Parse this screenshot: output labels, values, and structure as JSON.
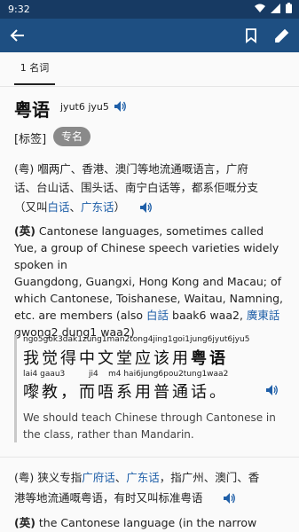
{
  "status": {
    "time": "9:32"
  },
  "toolbar": {
    "back": "back",
    "bookmark": "bookmark",
    "edit": "edit"
  },
  "tab": {
    "label": "1 名词"
  },
  "entry": {
    "headword": "粤语",
    "jyutping": "jyut6 jyu5",
    "tag_label": "[标签]",
    "tag_chip": "专名",
    "def1_zh_line1": "(粤) 嗰两广、香港、澳门等地流通嘅语言，广府",
    "def1_zh_line2": "话、台山话、围头话、南宁白话等，都系佢嘅分支",
    "aka_prefix": "（又叫",
    "aka_link1": "白话",
    "aka_sep": "、",
    "aka_link2": "广东话",
    "aka_suffix": "）",
    "def1_en_prefix": "(英)",
    "def1_en_line1": " Cantonese languages, sometimes called",
    "def1_en_line2": "Yue, a group of Chinese speech varieties widely spoken in",
    "def1_en_line3": "Guangdong, Guangxi, Hong Kong and Macau; of",
    "def1_en_line4": "which Cantonese, Toishanese, Waitau, Namning,",
    "def1_en_line5_a": "etc. are members (also ",
    "def1_en_link1": "白話",
    "def1_en_line5_b": " baak6 waa2, ",
    "def1_en_link2": "廣東話",
    "def1_en_line6": "gwong2 dung1 waa2)"
  },
  "example": {
    "pron1": "ngo5gok3dak1zung1man2tong4jing1goi1jung6jyut6jyu5",
    "line1_plain": "我觉得中文堂应该用",
    "line1_bold": "粤语",
    "pron2_a": "lai4 gaau3",
    "pron2_b": "ji4",
    "pron2_c": "m4 hai6jung6pou2tung1waa2",
    "line2": "嚟教，而唔系用普通话。",
    "translation_line1": "We should teach Chinese through Cantonese in",
    "translation_line2": "the class, rather than Mandarin."
  },
  "def2": {
    "zh_prefix": "(粤) 狭义专指",
    "link1": "广府话",
    "sep": "、",
    "link2": "广东话",
    "zh_rest": "，指广州、澳门、香",
    "zh_line2": "港等地流通嘅粤语，有时又叫标准粤语",
    "en_prefix": "(英)",
    "en_text": " the Cantonese language (in the narrow"
  },
  "colors": {
    "status": "#173a63",
    "appbar": "#1e4f82",
    "link": "#1f5fa8",
    "chip": "#8a8a8a"
  }
}
